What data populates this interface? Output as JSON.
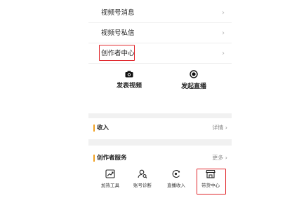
{
  "menu": [
    {
      "label": "视频号消息",
      "chevron": "›"
    },
    {
      "label": "视频号私信",
      "chevron": "›"
    },
    {
      "label": "创作者中心",
      "chevron": "›"
    }
  ],
  "actions": {
    "post_video": {
      "label": "发表视频",
      "icon": "camera-icon"
    },
    "start_live": {
      "label": "发起直播",
      "icon": "live-record-icon"
    }
  },
  "income": {
    "title": "收入",
    "more": "详情 ›"
  },
  "creator_services": {
    "title": "创作者服务",
    "more": "更多 ›",
    "items": [
      {
        "label": "加热工具",
        "icon": "chart-trend-icon"
      },
      {
        "label": "账号诊断",
        "icon": "account-diagnosis-icon"
      },
      {
        "label": "直播收入",
        "icon": "live-income-icon"
      },
      {
        "label": "带货中心",
        "icon": "store-icon"
      }
    ]
  },
  "colors": {
    "highlight": "#e0262b",
    "section_accent": "#f0a020",
    "separator": "#f1f1f1"
  }
}
